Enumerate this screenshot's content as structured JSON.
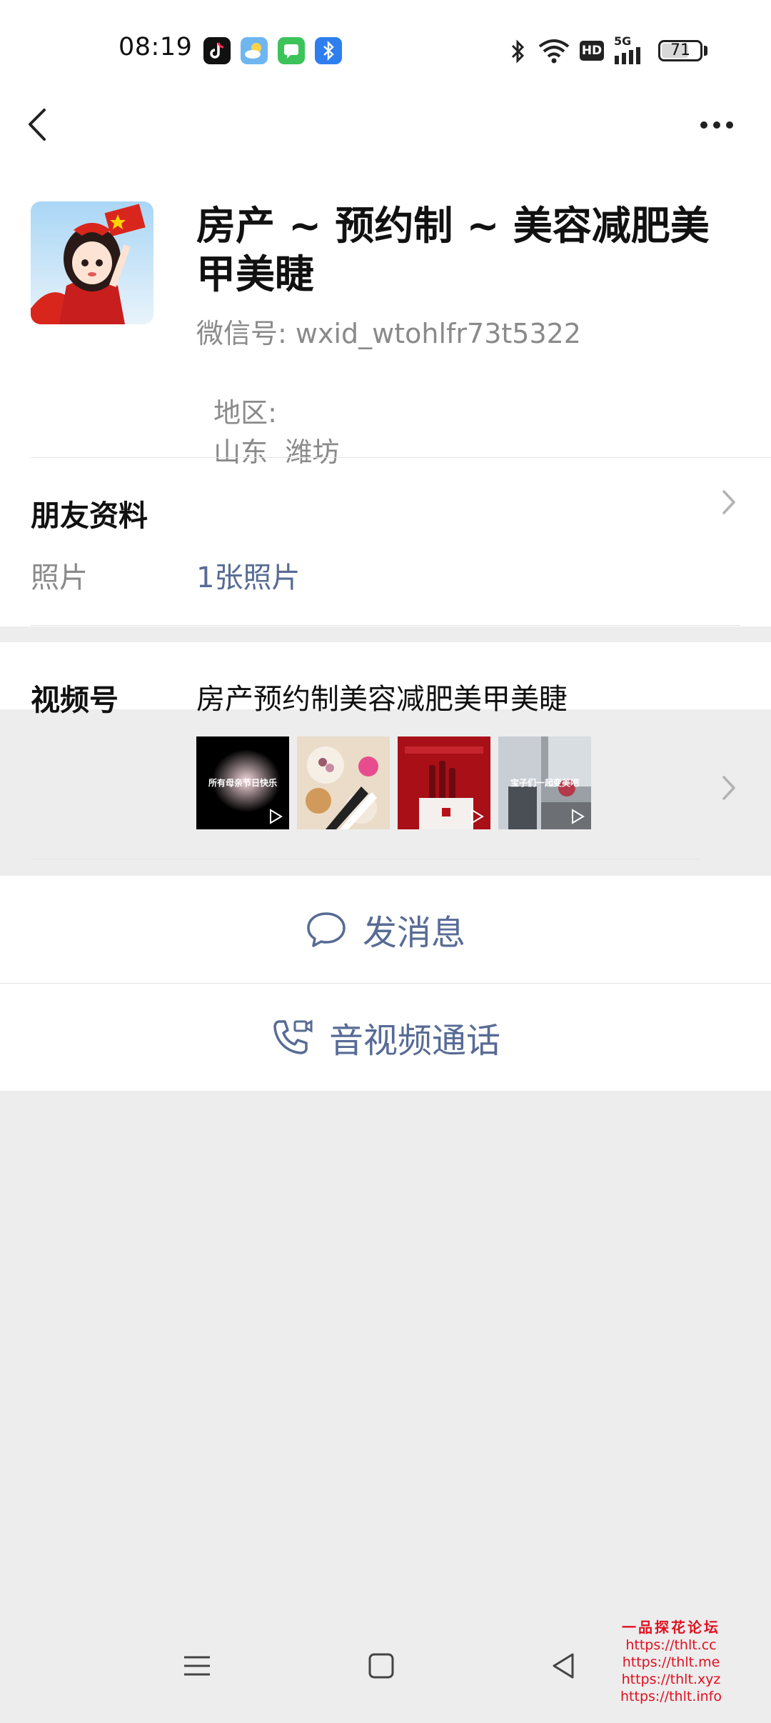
{
  "status_bar": {
    "time": "08:19",
    "network": "5G",
    "hd_label": "HD",
    "battery": "71",
    "battery_level": 0.71,
    "app_icons": [
      "tiktok-icon",
      "weather-icon",
      "messages-icon",
      "bluetooth-app-icon"
    ],
    "system_icons": [
      "bluetooth-icon",
      "wifi-icon",
      "hd-icon",
      "signal-icon",
      "battery-icon"
    ]
  },
  "nav": {
    "back_icon": "chevron-left-icon",
    "more_icon": "more-dots-icon"
  },
  "profile": {
    "name": "房产 ~ 预约制 ~ 美容减肥美甲美睫",
    "wechat_id_label": "微信号:",
    "wechat_id": "wxid_wtohlfr73t5322",
    "region_label": "地区:",
    "region": "山东  潍坊"
  },
  "friend_info": {
    "title": "朋友资料",
    "photos_label": "照片",
    "photos_value": "1张照片"
  },
  "channels": {
    "title": "视频号",
    "channel_name": "房产预约制美容减肥美甲美睫",
    "thumbnails": [
      {
        "caption": "所有母亲节日快乐"
      },
      {
        "caption": ""
      },
      {
        "caption": ""
      },
      {
        "caption": "宝子们一起变美吧"
      }
    ]
  },
  "actions": {
    "message": "发消息",
    "call": "音视频通话"
  },
  "watermark": {
    "title": "一品探花论坛",
    "links": [
      "https://thlt.cc",
      "https://thlt.me",
      "https://thlt.xyz",
      "https://thlt.info"
    ]
  },
  "colors": {
    "link": "#576b95",
    "background": "#ededed",
    "watermark": "#e0101f"
  }
}
